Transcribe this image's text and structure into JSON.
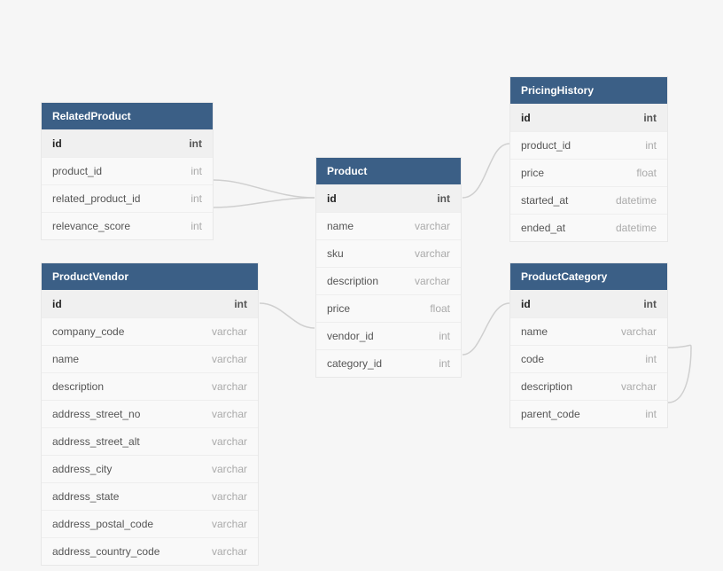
{
  "tables": {
    "relatedProduct": {
      "title": "RelatedProduct",
      "fields": [
        {
          "name": "id",
          "type": "int",
          "pk": true
        },
        {
          "name": "product_id",
          "type": "int"
        },
        {
          "name": "related_product_id",
          "type": "int"
        },
        {
          "name": "relevance_score",
          "type": "int"
        }
      ]
    },
    "productVendor": {
      "title": "ProductVendor",
      "fields": [
        {
          "name": "id",
          "type": "int",
          "pk": true
        },
        {
          "name": "company_code",
          "type": "varchar"
        },
        {
          "name": "name",
          "type": "varchar"
        },
        {
          "name": "description",
          "type": "varchar"
        },
        {
          "name": "address_street_no",
          "type": "varchar"
        },
        {
          "name": "address_street_alt",
          "type": "varchar"
        },
        {
          "name": "address_city",
          "type": "varchar"
        },
        {
          "name": "address_state",
          "type": "varchar"
        },
        {
          "name": "address_postal_code",
          "type": "varchar"
        },
        {
          "name": "address_country_code",
          "type": "varchar"
        }
      ]
    },
    "product": {
      "title": "Product",
      "fields": [
        {
          "name": "id",
          "type": "int",
          "pk": true
        },
        {
          "name": "name",
          "type": "varchar"
        },
        {
          "name": "sku",
          "type": "varchar"
        },
        {
          "name": "description",
          "type": "varchar"
        },
        {
          "name": "price",
          "type": "float"
        },
        {
          "name": "vendor_id",
          "type": "int"
        },
        {
          "name": "category_id",
          "type": "int"
        }
      ]
    },
    "pricingHistory": {
      "title": "PricingHistory",
      "fields": [
        {
          "name": "id",
          "type": "int",
          "pk": true
        },
        {
          "name": "product_id",
          "type": "int"
        },
        {
          "name": "price",
          "type": "float"
        },
        {
          "name": "started_at",
          "type": "datetime"
        },
        {
          "name": "ended_at",
          "type": "datetime"
        }
      ]
    },
    "productCategory": {
      "title": "ProductCategory",
      "fields": [
        {
          "name": "id",
          "type": "int",
          "pk": true
        },
        {
          "name": "name",
          "type": "varchar"
        },
        {
          "name": "code",
          "type": "int"
        },
        {
          "name": "description",
          "type": "varchar"
        },
        {
          "name": "parent_code",
          "type": "int"
        }
      ]
    }
  }
}
